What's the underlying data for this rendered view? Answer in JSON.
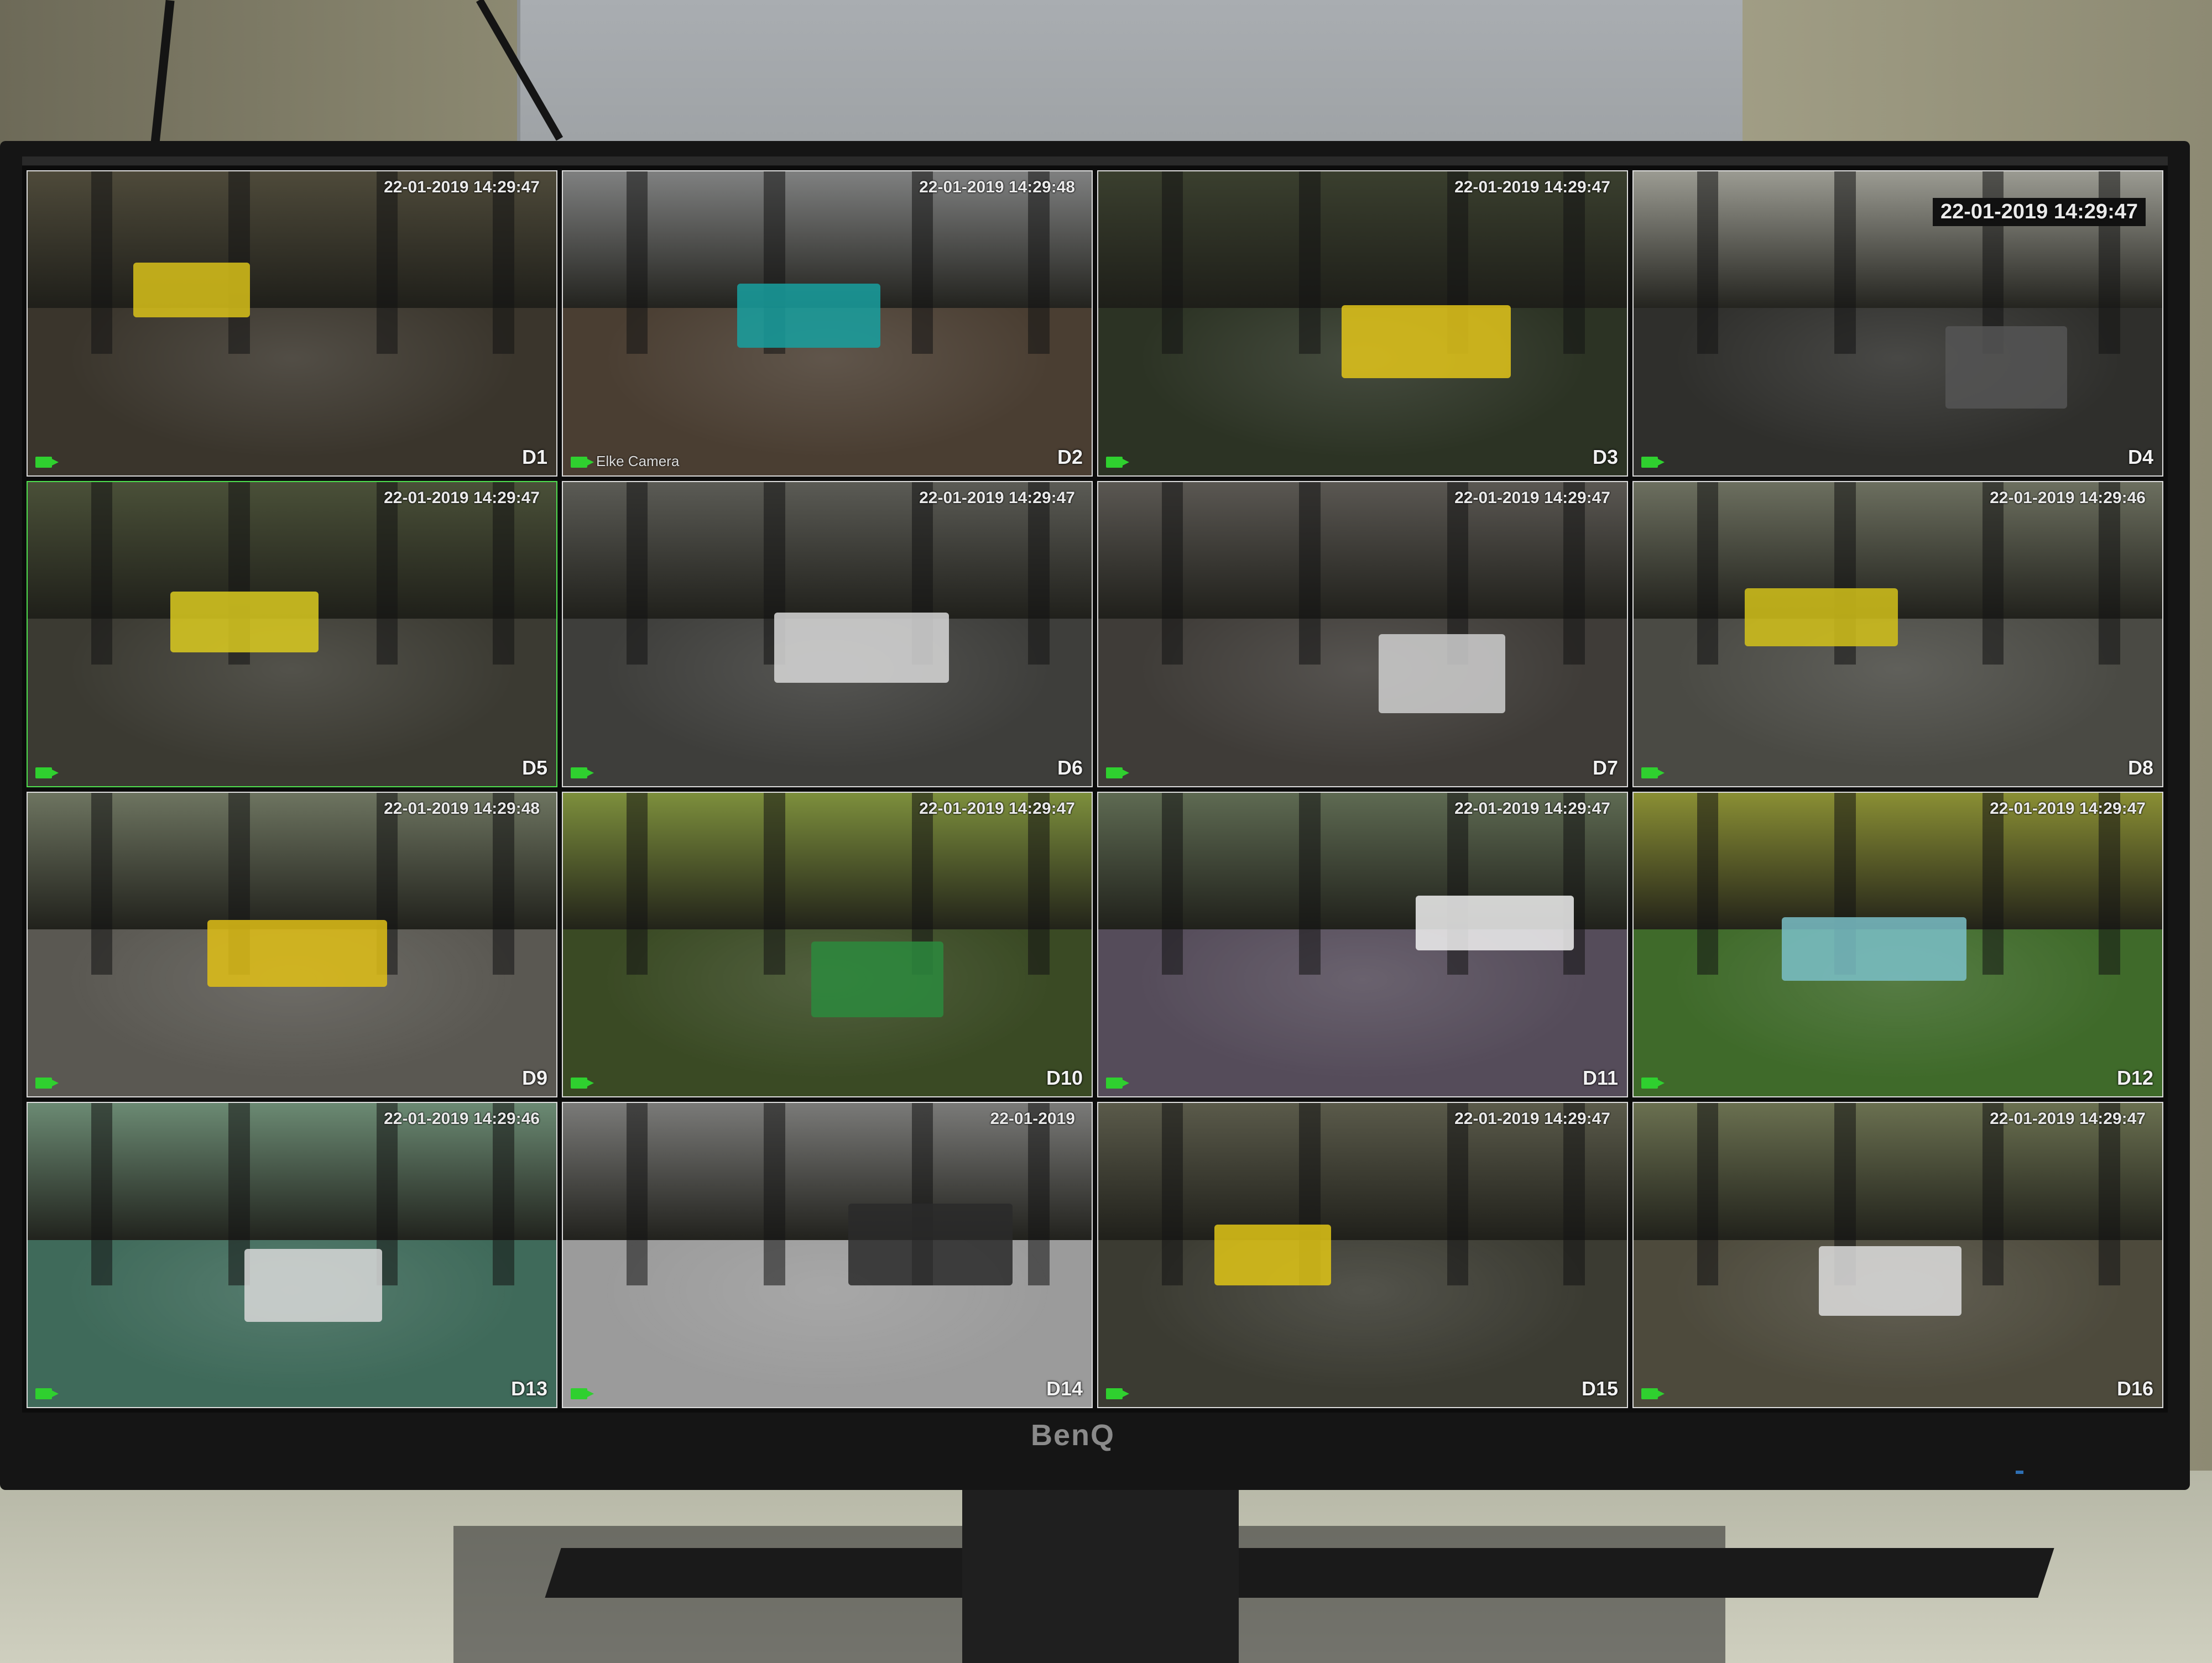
{
  "monitor": {
    "brand": "BenQ"
  },
  "cameras": [
    {
      "id": "D1",
      "timestamp": "22-01-2019 14:29:47",
      "selected": false,
      "boxed": false,
      "floor": "#3a352c",
      "top": "#4e4a3a",
      "accent": "#d9c21a",
      "extra": ""
    },
    {
      "id": "D2",
      "timestamp": "22-01-2019 14:29:48",
      "selected": false,
      "boxed": false,
      "floor": "#4a3e32",
      "top": "#7f8080",
      "accent": "#18a0a0",
      "extra": "Elke Camera"
    },
    {
      "id": "D3",
      "timestamp": "22-01-2019 14:29:47",
      "selected": false,
      "boxed": false,
      "floor": "#2c3324",
      "top": "#3a3f2e",
      "accent": "#e3c51a",
      "extra": ""
    },
    {
      "id": "D4",
      "timestamp": "22-01-2019 14:29:47",
      "selected": false,
      "boxed": true,
      "floor": "#2f2f2c",
      "top": "#9b9b92",
      "accent": "#555",
      "extra": ""
    },
    {
      "id": "D5",
      "timestamp": "22-01-2019 14:29:47",
      "selected": true,
      "boxed": false,
      "floor": "#3b3a32",
      "top": "#4a5038",
      "accent": "#dccb20",
      "extra": ""
    },
    {
      "id": "D6",
      "timestamp": "22-01-2019 14:29:47",
      "selected": false,
      "boxed": false,
      "floor": "#3e3e3b",
      "top": "#5b5b55",
      "accent": "#d8d8d8",
      "extra": ""
    },
    {
      "id": "D7",
      "timestamp": "22-01-2019 14:29:47",
      "selected": false,
      "boxed": false,
      "floor": "#3f3c38",
      "top": "#5a5752",
      "accent": "#cfcfcf",
      "extra": ""
    },
    {
      "id": "D8",
      "timestamp": "22-01-2019 14:29:46",
      "selected": false,
      "boxed": false,
      "floor": "#4a4a44",
      "top": "#6c6f5f",
      "accent": "#d4c21a",
      "extra": ""
    },
    {
      "id": "D9",
      "timestamp": "22-01-2019 14:29:48",
      "selected": false,
      "boxed": false,
      "floor": "#5a5852",
      "top": "#6d7460",
      "accent": "#e1bf16",
      "extra": ""
    },
    {
      "id": "D10",
      "timestamp": "22-01-2019 14:29:47",
      "selected": false,
      "boxed": false,
      "floor": "#3a4a24",
      "top": "#7d8f3c",
      "accent": "#2b8a3d",
      "extra": ""
    },
    {
      "id": "D11",
      "timestamp": "22-01-2019 14:29:47",
      "selected": false,
      "boxed": false,
      "floor": "#554c5a",
      "top": "#5e6a52",
      "accent": "#f0f0f0",
      "extra": ""
    },
    {
      "id": "D12",
      "timestamp": "22-01-2019 14:29:47",
      "selected": false,
      "boxed": false,
      "floor": "#3f6a2a",
      "top": "#8a8f34",
      "accent": "#7ac0c8",
      "extra": ""
    },
    {
      "id": "D13",
      "timestamp": "22-01-2019 14:29:46",
      "selected": false,
      "boxed": false,
      "floor": "#3f6a5a",
      "top": "#6b8a73",
      "accent": "#d8d8d8",
      "extra": ""
    },
    {
      "id": "D14",
      "timestamp": "22-01-2019",
      "selected": false,
      "boxed": false,
      "floor": "#9b9b9b",
      "top": "#7a7a78",
      "accent": "#2a2a2a",
      "extra": ""
    },
    {
      "id": "D15",
      "timestamp": "22-01-2019 14:29:47",
      "selected": false,
      "boxed": false,
      "floor": "#3b3b32",
      "top": "#5a5a4a",
      "accent": "#e0c516",
      "extra": ""
    },
    {
      "id": "D16",
      "timestamp": "22-01-2019 14:29:47",
      "selected": false,
      "boxed": false,
      "floor": "#4d4a3c",
      "top": "#6a7050",
      "accent": "#dedede",
      "extra": ""
    }
  ]
}
